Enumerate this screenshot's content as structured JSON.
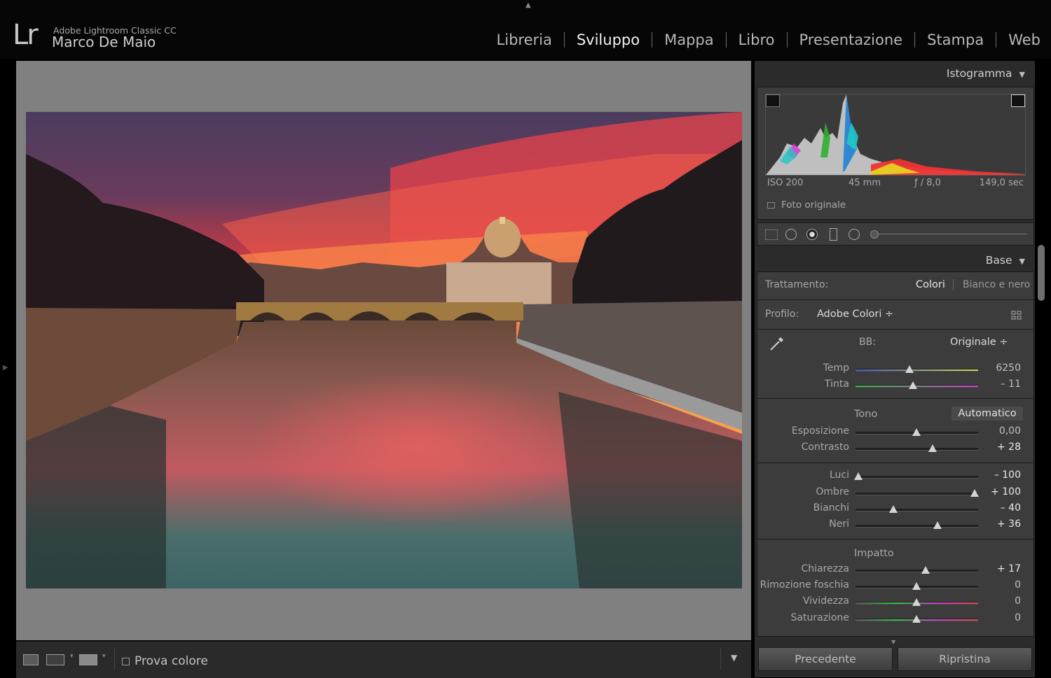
{
  "header": {
    "app_name": "Adobe Lightroom Classic CC",
    "user_name": "Marco De Maio",
    "logo_text": "Lr"
  },
  "modules": [
    {
      "label": "Libreria",
      "active": false
    },
    {
      "label": "Sviluppo",
      "active": true
    },
    {
      "label": "Mappa",
      "active": false
    },
    {
      "label": "Libro",
      "active": false
    },
    {
      "label": "Presentazione",
      "active": false
    },
    {
      "label": "Stampa",
      "active": false
    },
    {
      "label": "Web",
      "active": false
    }
  ],
  "toolbar": {
    "proof_label": "Prova colore"
  },
  "histogram": {
    "title": "Istogramma",
    "iso": "ISO 200",
    "focal": "45 mm",
    "aperture": "ƒ / 8,0",
    "shutter": "149,0 sec",
    "original_label": "Foto originale"
  },
  "base": {
    "title": "Base",
    "treatment_label": "Trattamento:",
    "treatment_color": "Colori",
    "treatment_bw": "Bianco e nero",
    "profile_label": "Profilo:",
    "profile_value": "Adobe Colori ÷",
    "wb_label": "BB:",
    "wb_value": "Originale ÷",
    "temp_label": "Temp",
    "temp_value": "6250",
    "tint_label": "Tinta",
    "tint_value": "– 11",
    "tone_label": "Tono",
    "auto_label": "Automatico",
    "exposure_label": "Esposizione",
    "exposure_value": "0,00",
    "contrast_label": "Contrasto",
    "contrast_value": "+ 28",
    "highlights_label": "Luci",
    "highlights_value": "– 100",
    "shadows_label": "Ombre",
    "shadows_value": "+ 100",
    "whites_label": "Bianchi",
    "whites_value": "– 40",
    "blacks_label": "Neri",
    "blacks_value": "+ 36",
    "presence_label": "Impatto",
    "clarity_label": "Chiarezza",
    "clarity_value": "+ 17",
    "dehaze_label": "Rimozione foschia",
    "dehaze_value": "0",
    "vibrance_label": "Vividezza",
    "vibrance_value": "0",
    "saturation_label": "Saturazione",
    "saturation_value": "0"
  },
  "slider_levels": {
    "temp": 0.44,
    "tint": 0.47,
    "exposure": 0.5,
    "contrast": 0.64,
    "highlights": 0.0,
    "shadows": 1.0,
    "whites": 0.3,
    "blacks": 0.68,
    "clarity": 0.58,
    "dehaze": 0.5,
    "vibrance": 0.5,
    "saturation": 0.5
  },
  "buttons": {
    "previous": "Precedente",
    "reset": "Ripristina"
  },
  "colors": {
    "accent_panel": "#2b2b2b",
    "canvas": "#808080"
  }
}
